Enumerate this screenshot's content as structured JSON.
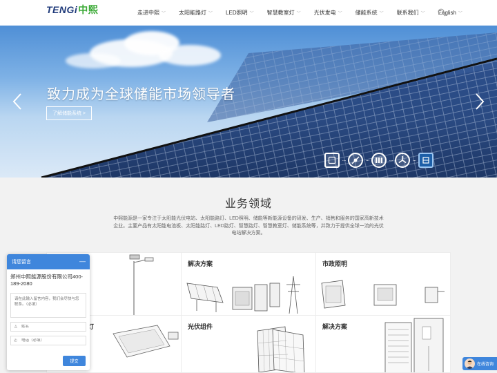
{
  "brand": {
    "latin": "TENGi",
    "chinese": "中熙"
  },
  "nav": {
    "items": [
      {
        "label": "走进中熙"
      },
      {
        "label": "太阳能路灯"
      },
      {
        "label": "LED照明"
      },
      {
        "label": "智慧教室灯"
      },
      {
        "label": "光伏发电"
      },
      {
        "label": "储能系统"
      },
      {
        "label": "联系我们"
      },
      {
        "label": "English"
      }
    ],
    "search_icon": "search-icon"
  },
  "banner": {
    "title": "致力成为全球储能市场领导者",
    "button_label": "了解储能系统 >",
    "thumbnails": [
      "solar-panel-icon",
      "ev-charger-icon",
      "battery-cabinet-icon",
      "wind-turbine-icon",
      "lamp-icon"
    ]
  },
  "business": {
    "title": "业务领域",
    "description": "中熙能源是一家专注于太阳能光伏电站、太阳能路灯、LED照明、储能等新能源设备的研发、生产、销售和服务的国家高新技术企业。主要产品有太阳能电池板、太阳能路灯、LED路灯、智慧路灯、智慧教室灯、储能系统等，并致力于提供全球一流的光伏电站解决方案。",
    "cards": [
      {
        "title": ""
      },
      {
        "title": "解决方案"
      },
      {
        "title": "市政照明"
      },
      {
        "title": "路灯"
      },
      {
        "title": "光伏组件"
      },
      {
        "title": "解决方案"
      }
    ]
  },
  "chat": {
    "title": "请您留言",
    "minimize": "—",
    "company": "郑州中熙能源股份有限公司400-189-2080",
    "message_placeholder": "请在此输入留言内容，我们会尽快与您联系。（必填）",
    "name_placeholder": "姓名",
    "phone_placeholder": "电话（必填）",
    "submit_label": "提交"
  },
  "online": {
    "label": "在线咨询"
  },
  "colors": {
    "accent": "#3f86dc",
    "brand_blue": "#1f3a7a",
    "brand_green": "#3aa935"
  }
}
